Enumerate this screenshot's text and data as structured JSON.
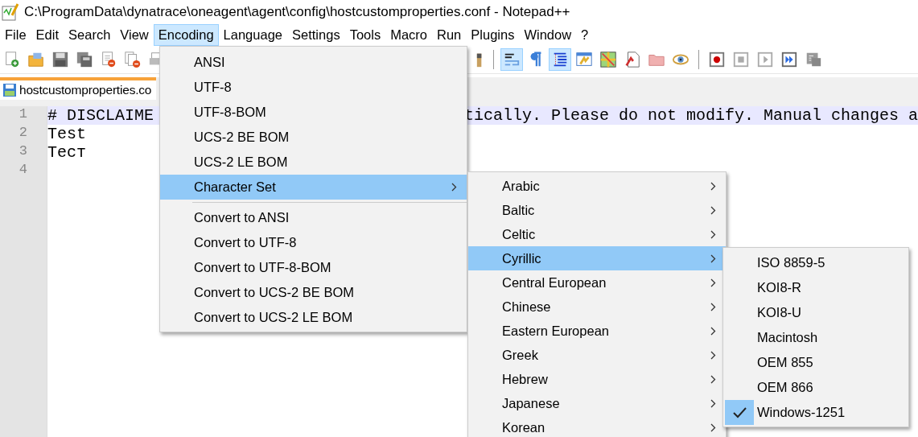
{
  "window": {
    "title": "C:\\ProgramData\\dynatrace\\oneagent\\agent\\config\\hostcustomproperties.conf - Notepad++"
  },
  "menubar": [
    {
      "label": "File",
      "selected": false
    },
    {
      "label": "Edit",
      "selected": false
    },
    {
      "label": "Search",
      "selected": false
    },
    {
      "label": "View",
      "selected": false
    },
    {
      "label": "Encoding",
      "selected": true
    },
    {
      "label": "Language",
      "selected": false
    },
    {
      "label": "Settings",
      "selected": false
    },
    {
      "label": "Tools",
      "selected": false
    },
    {
      "label": "Macro",
      "selected": false
    },
    {
      "label": "Run",
      "selected": false
    },
    {
      "label": "Plugins",
      "selected": false
    },
    {
      "label": "Window",
      "selected": false
    },
    {
      "label": "?",
      "selected": false
    }
  ],
  "toolbar": {
    "left": [
      {
        "kind": "new",
        "on": false
      },
      {
        "kind": "open",
        "on": false
      },
      {
        "kind": "save",
        "on": false
      },
      {
        "kind": "save-all",
        "on": false
      },
      {
        "kind": "close",
        "on": false
      },
      {
        "kind": "close-all",
        "on": false
      },
      {
        "kind": "print",
        "on": false
      }
    ],
    "right": [
      {
        "kind": "partial",
        "on": false
      },
      {
        "kind": "sep"
      },
      {
        "kind": "wrap",
        "on": true
      },
      {
        "kind": "pilcrow",
        "on": false
      },
      {
        "kind": "indent-guide",
        "on": true
      },
      {
        "kind": "window",
        "on": false
      },
      {
        "kind": "map",
        "on": false
      },
      {
        "kind": "function",
        "on": false
      },
      {
        "kind": "folder",
        "on": false
      },
      {
        "kind": "eye",
        "on": false
      },
      {
        "kind": "sep"
      },
      {
        "kind": "record",
        "on": false
      },
      {
        "kind": "stop",
        "on": false
      },
      {
        "kind": "play",
        "on": false
      },
      {
        "kind": "play-multi",
        "on": false
      },
      {
        "kind": "save-macro",
        "on": false
      }
    ]
  },
  "tab": {
    "label": "hostcustomproperties.co"
  },
  "editor": {
    "lines": [
      {
        "number": "1",
        "text": "# DISCLAIME",
        "text_continued": "tically. Please do not modify. Manual changes a",
        "current": true
      },
      {
        "number": "2",
        "text": "Test",
        "current": false
      },
      {
        "number": "3",
        "text": "Тест",
        "current": false
      },
      {
        "number": "4",
        "current": false
      }
    ]
  },
  "encoding_menu": [
    {
      "kind": "item",
      "label": "ANSI",
      "selected": false
    },
    {
      "kind": "item",
      "label": "UTF-8",
      "selected": false
    },
    {
      "kind": "item",
      "label": "UTF-8-BOM",
      "selected": false
    },
    {
      "kind": "item",
      "label": "UCS-2 BE BOM",
      "selected": false
    },
    {
      "kind": "item",
      "label": "UCS-2 LE BOM",
      "selected": false
    },
    {
      "kind": "submenu",
      "label": "Character Set",
      "selected": true
    },
    {
      "kind": "separator"
    },
    {
      "kind": "item",
      "label": "Convert to ANSI",
      "selected": false
    },
    {
      "kind": "item",
      "label": "Convert to UTF-8",
      "selected": false
    },
    {
      "kind": "item",
      "label": "Convert to UTF-8-BOM",
      "selected": false
    },
    {
      "kind": "item",
      "label": "Convert to UCS-2 BE BOM",
      "selected": false
    },
    {
      "kind": "item",
      "label": "Convert to UCS-2 LE BOM",
      "selected": false
    }
  ],
  "character_set_menu": [
    {
      "kind": "submenu",
      "label": "Arabic",
      "selected": false
    },
    {
      "kind": "submenu",
      "label": "Baltic",
      "selected": false
    },
    {
      "kind": "submenu",
      "label": "Celtic",
      "selected": false
    },
    {
      "kind": "submenu",
      "label": "Cyrillic",
      "selected": true
    },
    {
      "kind": "submenu",
      "label": "Central European",
      "selected": false
    },
    {
      "kind": "submenu",
      "label": "Chinese",
      "selected": false
    },
    {
      "kind": "submenu",
      "label": "Eastern European",
      "selected": false
    },
    {
      "kind": "submenu",
      "label": "Greek",
      "selected": false
    },
    {
      "kind": "submenu",
      "label": "Hebrew",
      "selected": false
    },
    {
      "kind": "submenu",
      "label": "Japanese",
      "selected": false
    },
    {
      "kind": "submenu",
      "label": "Korean",
      "selected": false
    }
  ],
  "cyrillic_menu": [
    {
      "kind": "item",
      "label": "ISO 8859-5",
      "selected": false,
      "checked": false
    },
    {
      "kind": "item",
      "label": "KOI8-R",
      "selected": false,
      "checked": false
    },
    {
      "kind": "item",
      "label": "KOI8-U",
      "selected": false,
      "checked": false
    },
    {
      "kind": "item",
      "label": "Macintosh",
      "selected": false,
      "checked": false
    },
    {
      "kind": "item",
      "label": "OEM 855",
      "selected": false,
      "checked": false
    },
    {
      "kind": "item",
      "label": "OEM 866",
      "selected": false,
      "checked": false
    },
    {
      "kind": "item",
      "label": "Windows-1251",
      "selected": false,
      "checked": true
    }
  ]
}
